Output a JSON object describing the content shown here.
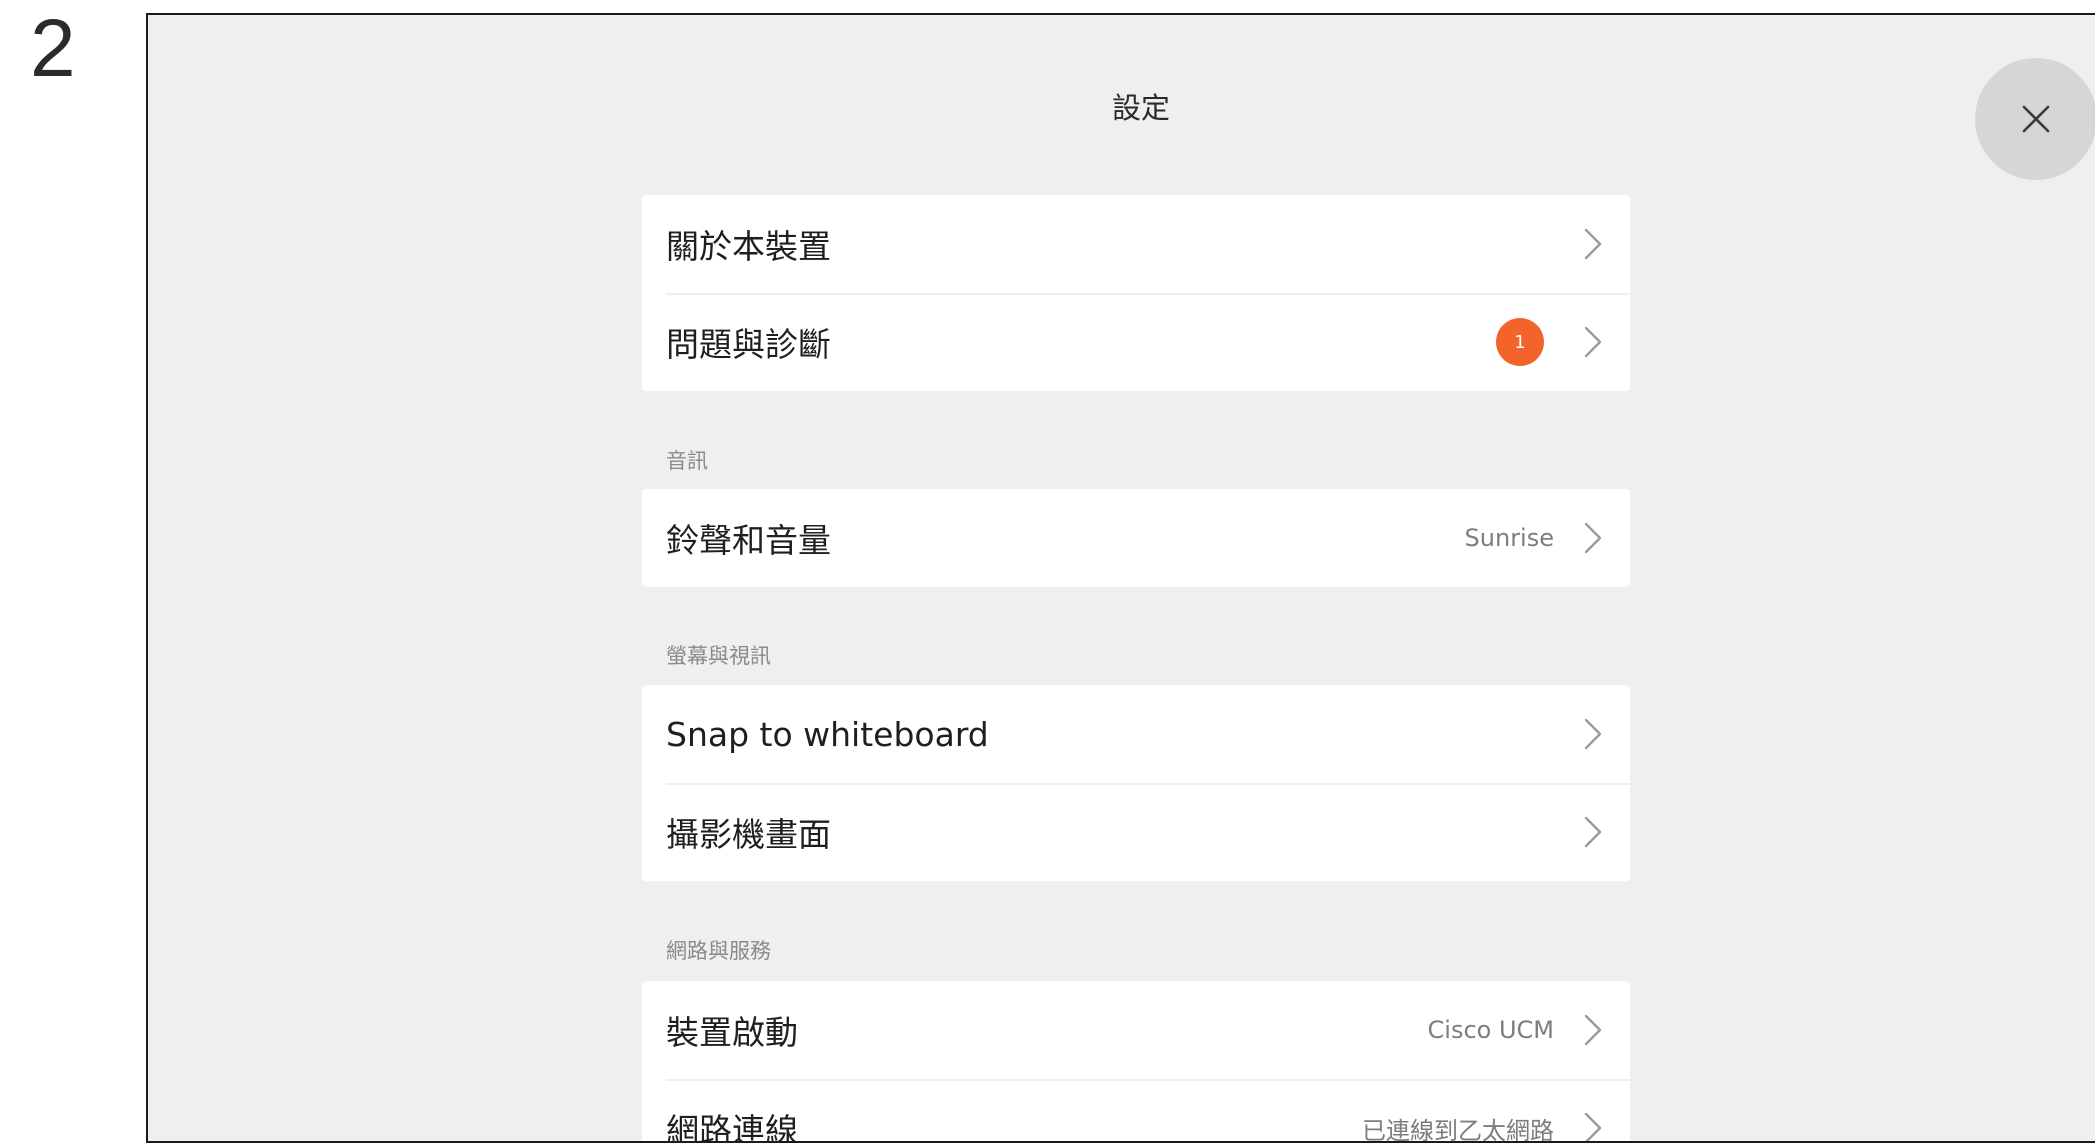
{
  "step_number": "2",
  "header": {
    "title": "設定"
  },
  "close_icon": "close-icon",
  "groups": [
    {
      "items": [
        {
          "label": "關於本裝置"
        },
        {
          "label": "問題與診斷",
          "badge": "1"
        }
      ]
    },
    {
      "header": "音訊",
      "items": [
        {
          "label": "鈴聲和音量",
          "value": "Sunrise"
        }
      ]
    },
    {
      "header": "螢幕與視訊",
      "items": [
        {
          "label": "Snap to whiteboard"
        },
        {
          "label": "攝影機畫面"
        }
      ]
    },
    {
      "header": "網路與服務",
      "items": [
        {
          "label": "裝置啟動",
          "value": "Cisco UCM"
        },
        {
          "label": "網路連線",
          "value": "已連線到乙太網路"
        }
      ]
    }
  ],
  "colors": {
    "background": "#efefef",
    "panel": "#ffffff",
    "badge": "#f2642c",
    "close_button": "#d6d6d6"
  }
}
